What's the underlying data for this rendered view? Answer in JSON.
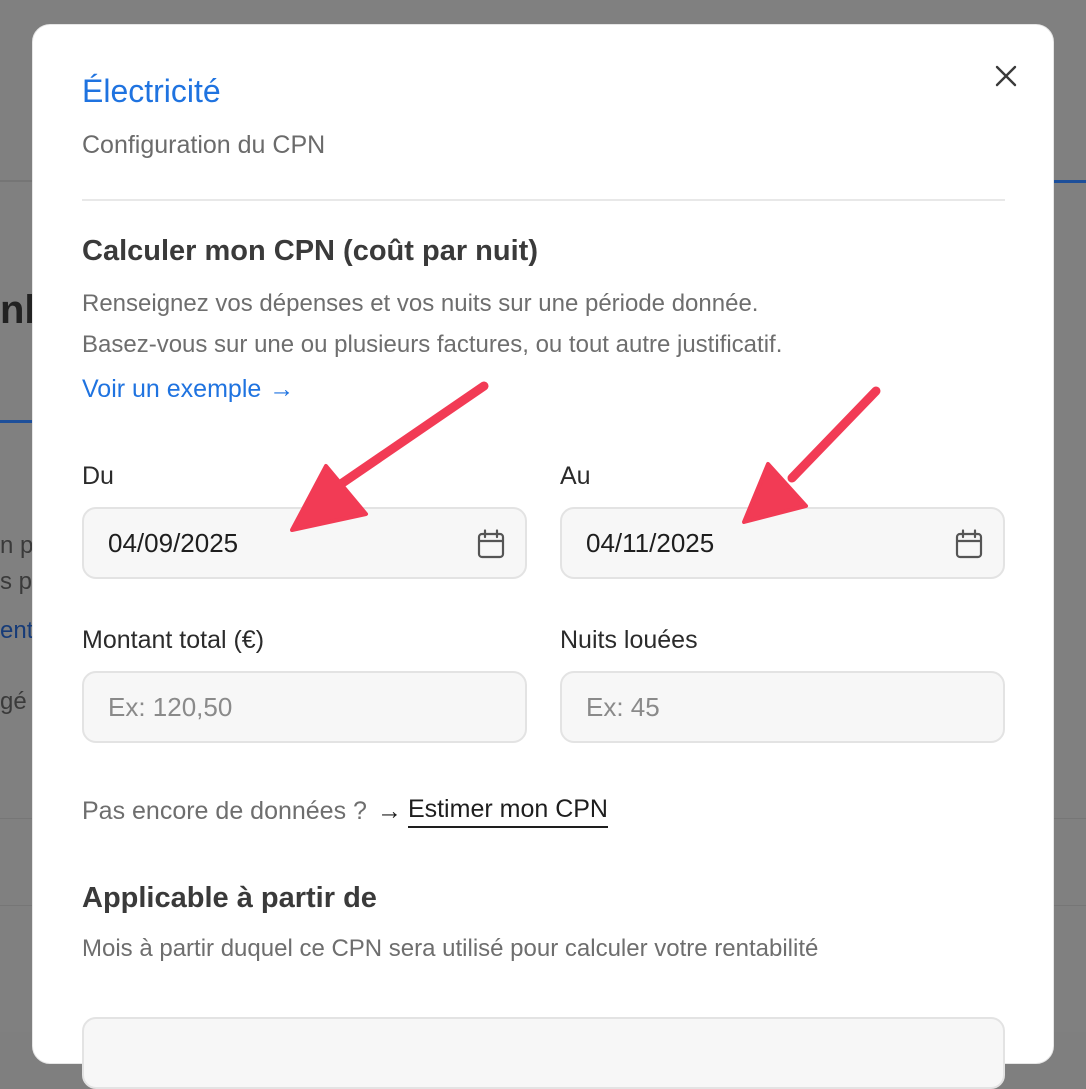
{
  "background": {
    "fragments": [
      "nb",
      "n pa",
      "s p",
      "ent",
      "gé"
    ]
  },
  "modal": {
    "title": "Électricité",
    "subtitle": "Configuration du CPN",
    "close_icon": "close-icon"
  },
  "cpn_section": {
    "title": "Calculer mon CPN (coût par nuit)",
    "description_line1": "Renseignez vos dépenses et vos nuits sur une période donnée.",
    "description_line2": "Basez-vous sur une ou plusieurs factures, ou tout autre justificatif.",
    "example_link": "Voir un exemple",
    "example_arrow": "→"
  },
  "form": {
    "from_label": "Du",
    "from_value": "04/09/2025",
    "to_label": "Au",
    "to_value": "04/11/2025",
    "amount_label": "Montant total (€)",
    "amount_placeholder": "Ex: 120,50",
    "nights_label": "Nuits louées",
    "nights_placeholder": "Ex: 45"
  },
  "hint": {
    "text": "Pas encore de données ?",
    "arrow": "→",
    "link": "Estimer mon CPN"
  },
  "applicable_section": {
    "title": "Applicable à partir de",
    "description": "Mois à partir duquel ce CPN sera utilisé pour calculer votre rentabilité"
  },
  "colors": {
    "accent": "#1f73e0",
    "annotation_arrow": "#f23b55"
  }
}
